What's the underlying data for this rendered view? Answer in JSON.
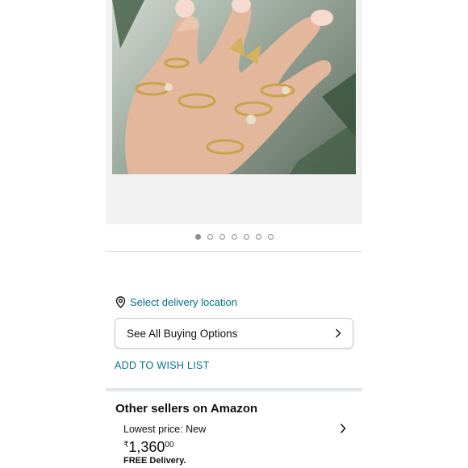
{
  "product": {
    "image_alt": "Gold rings on hand",
    "carousel": {
      "count": 7,
      "active_index": 0
    }
  },
  "delivery": {
    "label": "Select delivery location",
    "icon": "location-pin-icon"
  },
  "buying_options": {
    "label": "See All Buying Options",
    "icon": "chevron-right-icon"
  },
  "wish_list": {
    "label": "ADD TO WISH LIST"
  },
  "other_sellers": {
    "title": "Other sellers on Amazon",
    "lowest_price_label": "Lowest price: New",
    "currency_symbol": "₹",
    "price_whole": "1,360",
    "price_fraction": "00",
    "delivery_note": "FREE Delivery."
  },
  "colors": {
    "link": "#007185",
    "text": "#0f1111",
    "image_bg": "#f2f2f2",
    "divider": "#d5d9d9"
  }
}
